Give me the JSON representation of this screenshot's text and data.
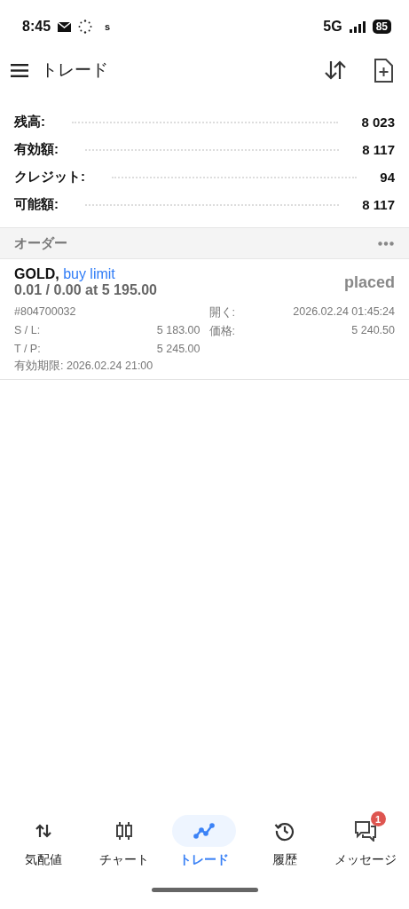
{
  "status_bar": {
    "time": "8:45",
    "carrier_letter": "s",
    "network": "5G",
    "battery": "85"
  },
  "toolbar": {
    "title": "トレード"
  },
  "balances": [
    {
      "label": "残高:",
      "value": "8 023"
    },
    {
      "label": "有効額:",
      "value": "8 117"
    },
    {
      "label": "クレジット:",
      "value": "94"
    },
    {
      "label": "可能額:",
      "value": "8 117"
    }
  ],
  "orders_header": {
    "title": "オーダー"
  },
  "orders": [
    {
      "symbol": "GOLD,",
      "type": "buy limit",
      "volume": "0.01 / 0.00 at 5 195.00",
      "status": "placed",
      "ticket": "#804700032",
      "open_label": "開く:",
      "open_time": "2026.02.24 01:45:24",
      "sl_label": "S / L:",
      "sl": "5 183.00",
      "price_label": "価格:",
      "price": "5 240.50",
      "tp_label": "T / P:",
      "tp": "5 245.00",
      "expiry": "有効期限: 2026.02.24 21:00"
    }
  ],
  "nav": [
    {
      "kind": "quotes",
      "label": "気配値",
      "selected": false
    },
    {
      "kind": "chart",
      "label": "チャート",
      "selected": false
    },
    {
      "kind": "trade",
      "label": "トレード",
      "selected": true
    },
    {
      "kind": "history",
      "label": "履歴",
      "selected": false
    },
    {
      "kind": "messages",
      "label": "メッセージ",
      "selected": false,
      "badge": "1"
    }
  ]
}
